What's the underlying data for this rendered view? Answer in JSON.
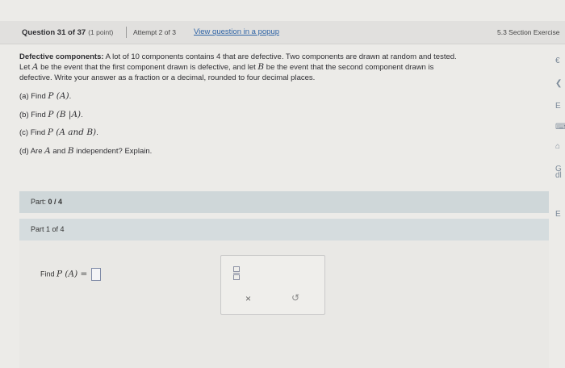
{
  "header": {
    "question_num": "Question 31 of 37",
    "points": "(1 point)",
    "attempt": "Attempt 2 of 3",
    "popup_link": "View question in a popup",
    "section": "5.3 Section Exercise"
  },
  "problem": {
    "title": "Defective components:",
    "text_1": "A lot of",
    "n_total": "10",
    "text_2": "components contains",
    "n_defective": "4",
    "text_3": "that are defective. Two components are drawn at random and tested.",
    "line2_a": "Let",
    "var_a": "A",
    "line2_b": "be the event that the first component drawn is defective, and let",
    "var_b": "B",
    "line2_c": "be the event that the second component drawn is",
    "line3": "defective. Write your answer as a fraction or a decimal, rounded to four decimal places."
  },
  "parts": [
    {
      "prefix": "(a) Find",
      "expr": "P (A)",
      "suffix": "."
    },
    {
      "prefix": "(b) Find",
      "expr": "P (B |A)",
      "suffix": "."
    },
    {
      "prefix": "(c) Find",
      "expr": "P (A  and  B)",
      "suffix": "."
    },
    {
      "prefix": "(d) Are",
      "a": "A",
      "mid": "and",
      "b": "B",
      "suffix": "independent? Explain."
    }
  ],
  "parts_bar": {
    "label": "Part:",
    "score": "0 / 4"
  },
  "part_header": "Part 1 of 4",
  "answer": {
    "label": "Find",
    "expr": "P (A) ="
  },
  "keypad": {
    "x_label": "×",
    "undo_label": "↺"
  },
  "edge_glyphs": [
    "€",
    "❮",
    "E",
    "⌨",
    "⌂",
    "G",
    "dl",
    "E"
  ]
}
